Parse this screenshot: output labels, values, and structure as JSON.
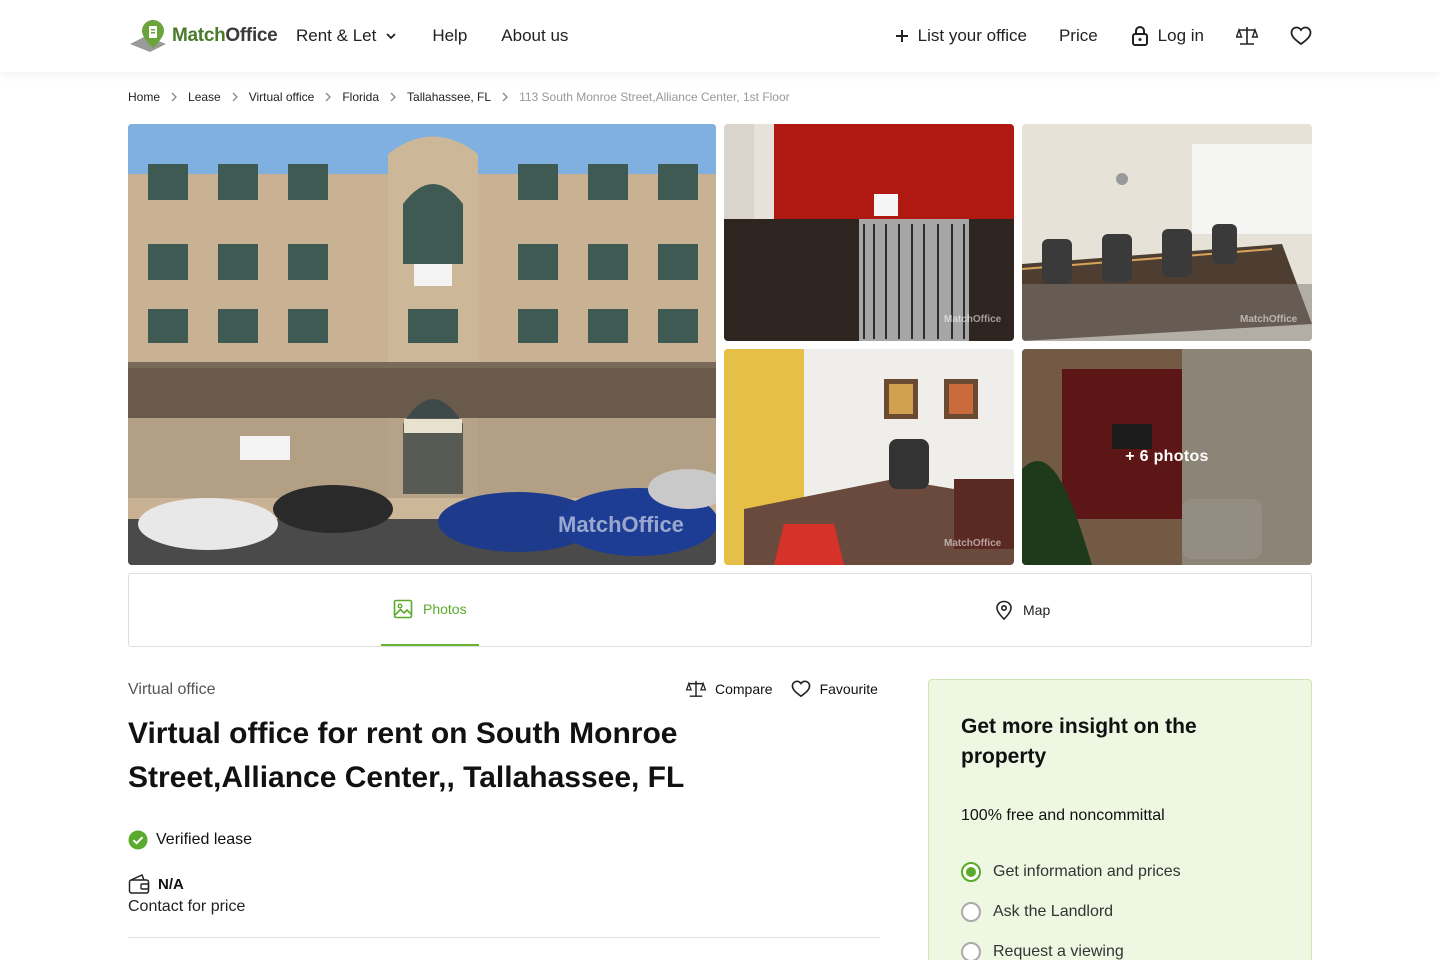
{
  "brand": {
    "name_part1": "Match",
    "name_part2": "Office"
  },
  "nav": {
    "rent_let": "Rent & Let",
    "help": "Help",
    "about": "About us",
    "list_office": "List your office",
    "price": "Price",
    "login": "Log in"
  },
  "breadcrumb": {
    "items": [
      "Home",
      "Lease",
      "Virtual office",
      "Florida",
      "Tallahassee, FL"
    ],
    "current": "113 South Monroe Street,Alliance Center, 1st Floor"
  },
  "gallery": {
    "more_photos": "+ 6 photos",
    "watermark": "MatchOffice"
  },
  "tabs": {
    "photos": "Photos",
    "map": "Map"
  },
  "listing": {
    "type": "Virtual office",
    "compare": "Compare",
    "favourite": "Favourite",
    "title": "Virtual office for rent on South Monroe Street,Alliance Center,, Tallahassee, FL",
    "verified": "Verified lease",
    "price_value": "N/A",
    "price_note": "Contact for price"
  },
  "insight_card": {
    "title": "Get more insight on the property",
    "subtitle": "100% free and noncommittal",
    "options": [
      "Get information and prices",
      "Ask the Landlord",
      "Request a viewing"
    ],
    "selected_index": 0
  },
  "colors": {
    "accent": "#5aab2c",
    "card_bg": "#edf7e1"
  }
}
